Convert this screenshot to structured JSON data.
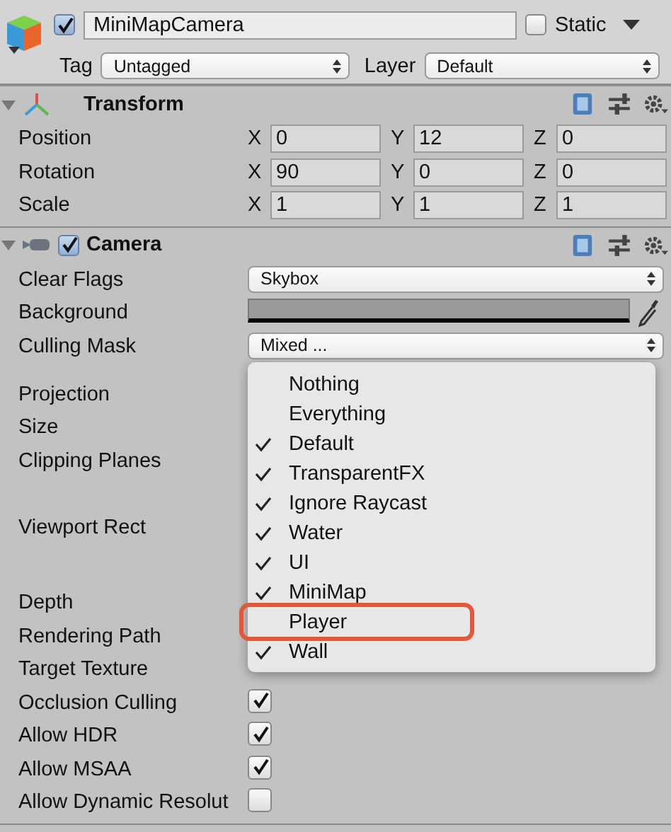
{
  "object": {
    "active": true,
    "name": "MiniMapCamera",
    "static": false,
    "static_label": "Static",
    "tag_label": "Tag",
    "tag": "Untagged",
    "layer_label": "Layer",
    "layer": "Default"
  },
  "transform": {
    "title": "Transform",
    "expanded": true,
    "rows": [
      {
        "label": "Position",
        "values": [
          {
            "axis": "X",
            "value": "0"
          },
          {
            "axis": "Y",
            "value": "12"
          },
          {
            "axis": "Z",
            "value": "0"
          }
        ]
      },
      {
        "label": "Rotation",
        "values": [
          {
            "axis": "X",
            "value": "90"
          },
          {
            "axis": "Y",
            "value": "0"
          },
          {
            "axis": "Z",
            "value": "0"
          }
        ]
      },
      {
        "label": "Scale",
        "values": [
          {
            "axis": "X",
            "value": "1"
          },
          {
            "axis": "Y",
            "value": "1"
          },
          {
            "axis": "Z",
            "value": "1"
          }
        ]
      }
    ]
  },
  "camera": {
    "title": "Camera",
    "enabled": true,
    "expanded": true,
    "properties": [
      {
        "label": "Clear Flags",
        "kind": "dropdown",
        "value": "Skybox"
      },
      {
        "label": "Background",
        "kind": "color"
      },
      {
        "label": "Culling Mask",
        "kind": "dropdown",
        "value": "Mixed ..."
      },
      {
        "label": "Projection",
        "kind": "covered"
      },
      {
        "label": "Size",
        "kind": "covered"
      },
      {
        "label": "Clipping Planes",
        "kind": "range"
      },
      {
        "label": "Viewport Rect",
        "kind": "rect"
      },
      {
        "label": "Depth",
        "kind": "covered"
      },
      {
        "label": "Rendering Path",
        "kind": "covered"
      },
      {
        "label": "Target Texture",
        "kind": "covered"
      },
      {
        "label": "Occlusion Culling",
        "kind": "checkbox",
        "checked": true
      },
      {
        "label": "Allow HDR",
        "kind": "checkbox",
        "checked": true
      },
      {
        "label": "Allow MSAA",
        "kind": "checkbox",
        "checked": true
      },
      {
        "label": "Allow Dynamic Resolut",
        "kind": "checkbox",
        "checked": false
      }
    ]
  },
  "culling_menu": {
    "items": [
      {
        "label": "Nothing",
        "checked": false,
        "highlighted": false
      },
      {
        "label": "Everything",
        "checked": false,
        "highlighted": false
      },
      {
        "label": "Default",
        "checked": true,
        "highlighted": false
      },
      {
        "label": "TransparentFX",
        "checked": true,
        "highlighted": false
      },
      {
        "label": "Ignore Raycast",
        "checked": true,
        "highlighted": false
      },
      {
        "label": "Water",
        "checked": true,
        "highlighted": false
      },
      {
        "label": "UI",
        "checked": true,
        "highlighted": false
      },
      {
        "label": "MiniMap",
        "checked": true,
        "highlighted": false
      },
      {
        "label": "Player",
        "checked": false,
        "highlighted": true
      },
      {
        "label": "Wall",
        "checked": true,
        "highlighted": false
      }
    ]
  }
}
